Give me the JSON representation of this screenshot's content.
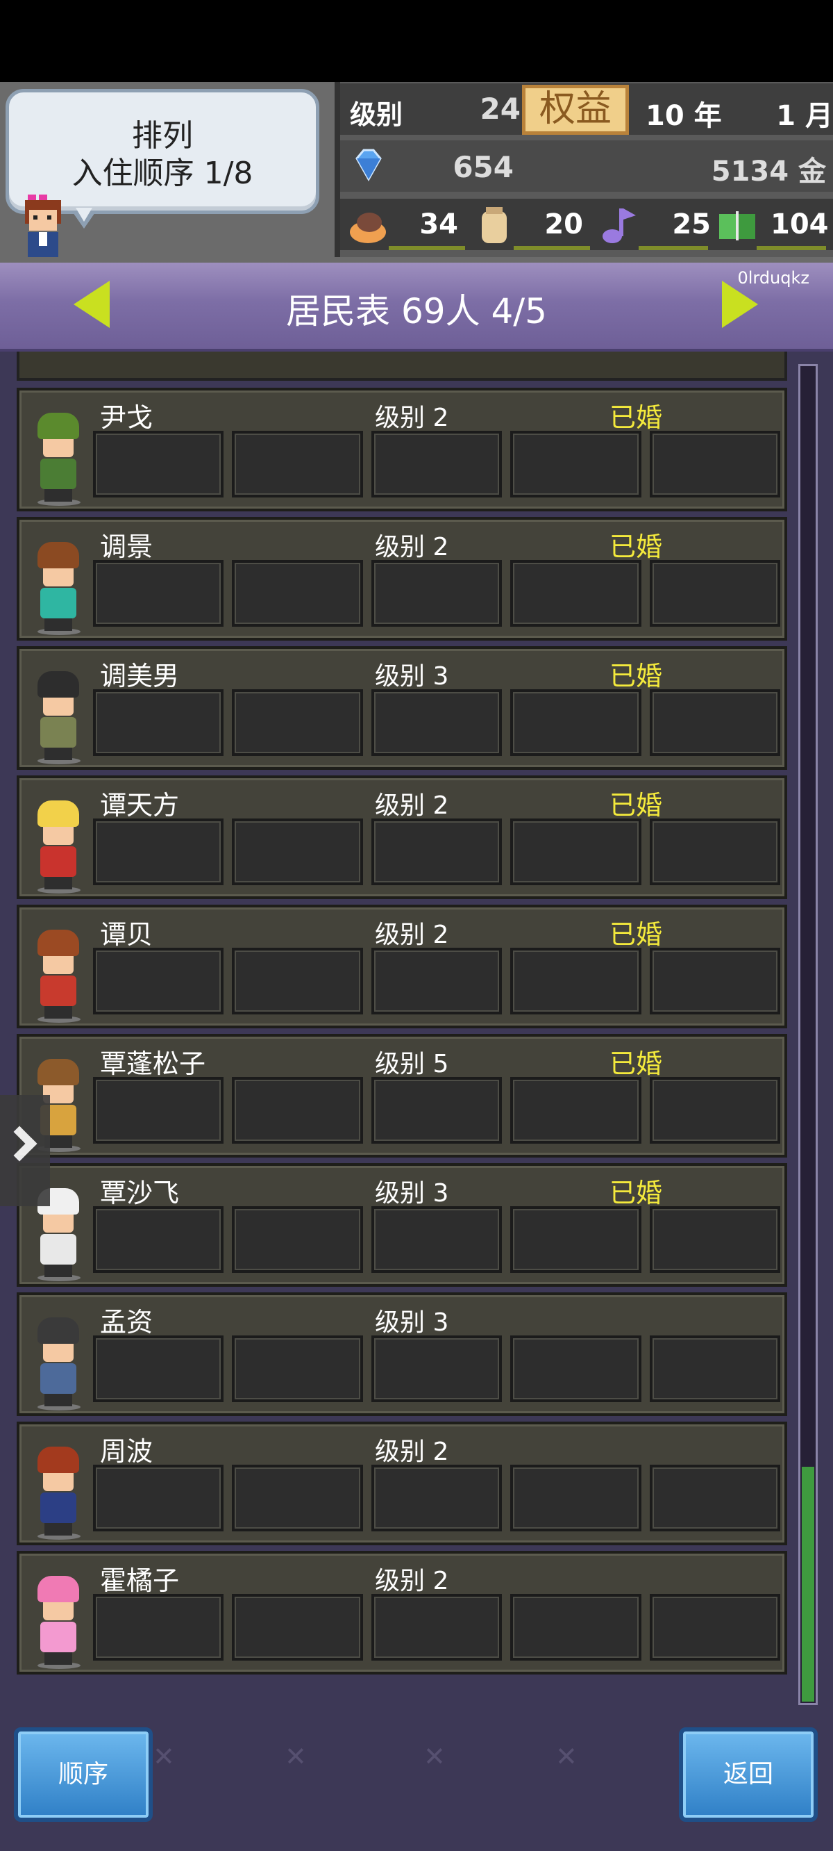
{
  "sort": {
    "title": "排列",
    "value": "入住顺序 1/8"
  },
  "stats": {
    "level_label": "级别",
    "level_value": "24",
    "perks_label": "权益",
    "year": "10 年",
    "month": "1 月",
    "gems": "654",
    "gold": "5134 金",
    "food": "34",
    "goods": "20",
    "music": "25",
    "books": "104"
  },
  "header": {
    "title": "居民表 69人  4/5",
    "user_tag": "0lrduqkz"
  },
  "residents": [
    {
      "name": "尹戈",
      "level": "级别 2",
      "status": "已婚",
      "hair": "#5b8a2d",
      "shirt": "#4b7d34"
    },
    {
      "name": "调景",
      "level": "级别 2",
      "status": "已婚",
      "hair": "#8b4a22",
      "shirt": "#2fb6a2"
    },
    {
      "name": "调美男",
      "level": "级别 3",
      "status": "已婚",
      "hair": "#2d2d2d",
      "shirt": "#7a8252"
    },
    {
      "name": "谭天方",
      "level": "级别 2",
      "status": "已婚",
      "hair": "#f2d14a",
      "shirt": "#c9332d"
    },
    {
      "name": "谭贝",
      "level": "级别 2",
      "status": "已婚",
      "hair": "#9b4a23",
      "shirt": "#c83a2d"
    },
    {
      "name": "覃蓬松子",
      "level": "级别 5",
      "status": "已婚",
      "hair": "#8c5a2b",
      "shirt": "#d8a33e"
    },
    {
      "name": "覃沙飞",
      "level": "级别 3",
      "status": "已婚",
      "hair": "#f0f0f0",
      "shirt": "#e8e8e8"
    },
    {
      "name": "孟资",
      "level": "级别 3",
      "status": "",
      "hair": "#3a3a3a",
      "shirt": "#4d6a9a"
    },
    {
      "name": "周波",
      "level": "级别 2",
      "status": "",
      "hair": "#a33a1e",
      "shirt": "#2c3f85"
    },
    {
      "name": "霍橘子",
      "level": "级别 2",
      "status": "",
      "hair": "#f07ab4",
      "shirt": "#f39ad0"
    }
  ],
  "buttons": {
    "order": "顺序",
    "back": "返回"
  },
  "scroll": {
    "position": 0.95
  }
}
